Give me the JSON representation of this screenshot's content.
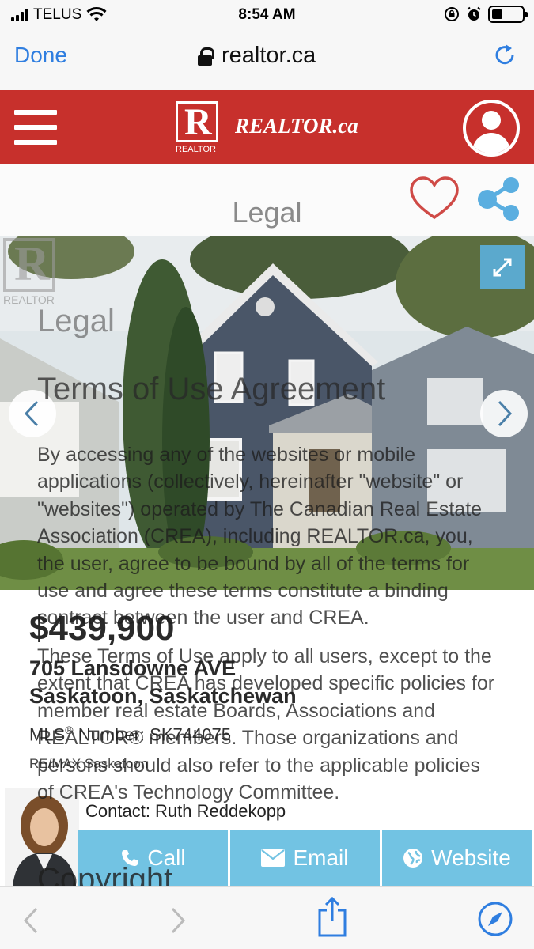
{
  "status_bar": {
    "carrier": "TELUS",
    "time": "8:54 AM"
  },
  "browser": {
    "done_label": "Done",
    "url": "realtor.ca"
  },
  "site_header": {
    "logo_caption": "REALTOR",
    "brand": "REALTOR.ca"
  },
  "listing": {
    "section_label": "Legal",
    "watermark_caption": "REALTOR",
    "price": "$439,900",
    "address_line1": "705 Lansdowne AVE",
    "address_line2": "Saskatoon, Saskatchewan",
    "mls_prefix": "MLS",
    "mls_label": " Number: ",
    "mls_number": "SK744075",
    "brokerage": "RE/MAX Saskatoon"
  },
  "contact": {
    "name": "Contact: Ruth Reddekopp",
    "buttons": {
      "call": "Call",
      "email": "Email",
      "website": "Website"
    }
  },
  "overlay_terms": {
    "heading": "Legal",
    "title": "Terms of Use Agreement",
    "paragraph1": "By accessing any of the websites or mobile applications (collectively, hereinafter \"website\" or \"websites\") operated by The Canadian Real Estate Association (CREA), including REALTOR.ca, you, the user, agree to be bound by all of the terms for use and agree these terms constitute a binding contract between the user and CREA.",
    "paragraph2": "These Terms of Use apply to all users, except to the extent that CREA has developed specific policies for member real estate Boards, Associations and REALTOR® members. Those organizations and persons should also refer to the applicable policies of CREA's Technology Committee.",
    "next_heading": "Copyright"
  },
  "icons": [
    "signal-icon",
    "wifi-icon",
    "lock-icon",
    "alarm-icon",
    "battery-icon",
    "reload-icon",
    "menu-icon",
    "user-icon",
    "heart-icon",
    "share-icon",
    "expand-icon",
    "chevron-left-icon",
    "chevron-right-icon",
    "phone-icon",
    "envelope-icon",
    "globe-icon",
    "back-icon",
    "forward-icon",
    "share-sheet-icon",
    "compass-icon"
  ],
  "colors": {
    "realtor_red": "#c7302c",
    "ios_blue": "#2f7ee0",
    "contact_button": "#72c3e3"
  }
}
